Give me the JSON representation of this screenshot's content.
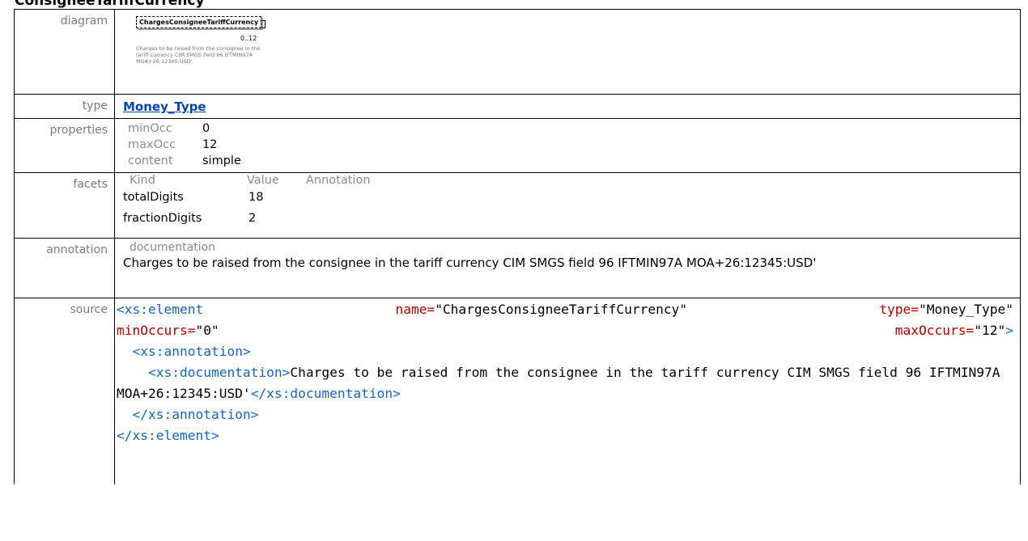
{
  "title": "ConsigneeTariffCurrency",
  "rows": {
    "diagram": {
      "label": "diagram",
      "element_name": "ChargesConsigneeTariffCurrency",
      "occurrence": "0..12",
      "doc": "Charges to be raised from the consignee in the tariff currency CIM SMGS field 96 IFTMIN97A MOA+26:12345:USD'"
    },
    "type": {
      "label": "type",
      "link": "Money_Type"
    },
    "properties": {
      "label": "properties",
      "items": [
        {
          "key": "minOcc",
          "value": "0"
        },
        {
          "key": "maxOcc",
          "value": "12"
        },
        {
          "key": "content",
          "value": "simple"
        }
      ]
    },
    "facets": {
      "label": "facets",
      "headers": [
        "Kind",
        "Value",
        "Annotation"
      ],
      "items": [
        {
          "kind": "totalDigits",
          "value": "18",
          "annotation": ""
        },
        {
          "kind": "fractionDigits",
          "value": "2",
          "annotation": ""
        }
      ]
    },
    "annotation": {
      "label": "annotation",
      "heading": "documentation",
      "text": "Charges to be raised from the consignee in the tariff currency CIM SMGS field 96 IFTMIN97A MOA+26:12345:USD'"
    },
    "source": {
      "label": "source",
      "el_open": "<xs:element",
      "name_attr": "name=",
      "name_val": "\"ChargesConsigneeTariffCurrency\"",
      "type_attr": "type=",
      "type_val": "\"Money_Type\"",
      "minocc_attr": "minOccurs=",
      "minocc_val": "\"0\"",
      "maxocc_attr": "maxOccurs=",
      "maxocc_val": "\"12\"",
      "gt": ">",
      "ann_open": "<xs:annotation>",
      "doc_open": "<xs:documentation>",
      "doc_text": "Charges to be raised from the consignee in the tariff currency CIM SMGS field 96 IFTMIN97A MOA+26:12345:USD'",
      "doc_close": "</xs:documentation>",
      "ann_close": "</xs:annotation>",
      "el_close": "</xs:element>"
    }
  }
}
